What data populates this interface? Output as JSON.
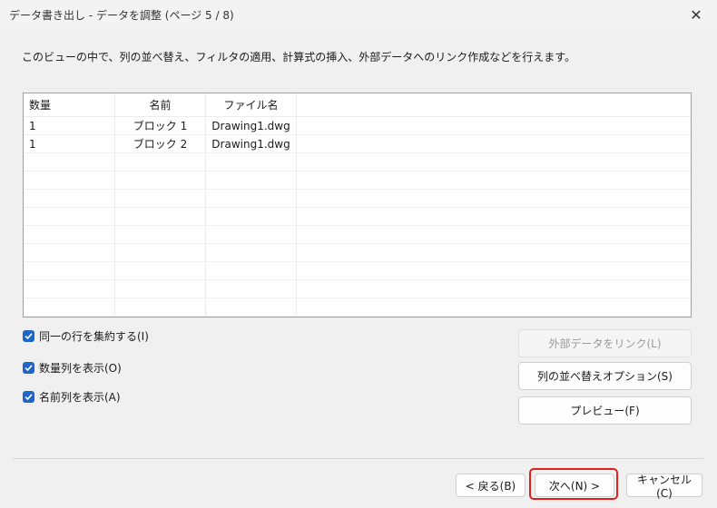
{
  "window": {
    "title": "データ書き出し - データを調整 (ページ 5 / 8)",
    "close_symbol": "✕"
  },
  "instruction": "このビューの中で、列の並べ替え、フィルタの適用、計算式の挿入、外部データへのリンク作成などを行えます。",
  "grid": {
    "columns": [
      "数量",
      "名前",
      "ファイル名",
      ""
    ],
    "rows": [
      [
        "1",
        "ブロック 1",
        "Drawing1.dwg",
        ""
      ],
      [
        "1",
        "ブロック 2",
        "Drawing1.dwg",
        ""
      ]
    ]
  },
  "options": [
    {
      "label": "同一の行を集約する(I)",
      "checked": true
    },
    {
      "label": "数量列を表示(O)",
      "checked": true
    },
    {
      "label": "名前列を表示(A)",
      "checked": true
    }
  ],
  "side_buttons": {
    "link_external": "外部データをリンク(L)",
    "sort_options": "列の並べ替えオプション(S)",
    "preview": "プレビュー(F)"
  },
  "footer_buttons": {
    "back": "< 戻る(B)",
    "next": "次へ(N) >",
    "cancel": "キャンセル(C)"
  },
  "colors": {
    "checkbox": "#1e66c8",
    "highlight": "#e0201b"
  }
}
